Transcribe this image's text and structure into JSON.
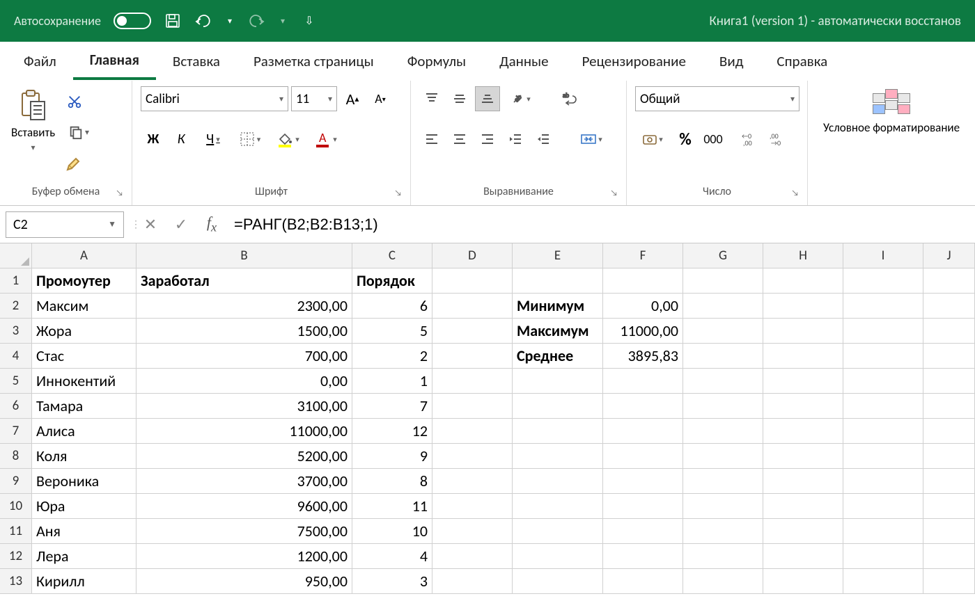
{
  "titlebar": {
    "autosave": "Автосохранение",
    "doc_title": "Книга1 (version 1)  -  автоматически восстанов"
  },
  "tabs": {
    "file": "Файл",
    "home": "Главная",
    "insert": "Вставка",
    "layout": "Разметка страницы",
    "formulas": "Формулы",
    "data": "Данные",
    "review": "Рецензирование",
    "view": "Вид",
    "help": "Справка"
  },
  "ribbon": {
    "clipboard": {
      "paste": "Вставить",
      "label": "Буфер обмена"
    },
    "font": {
      "name": "Calibri",
      "size": "11",
      "label": "Шрифт",
      "bold": "Ж",
      "italic": "К",
      "underline": "Ч"
    },
    "alignment": {
      "label": "Выравнивание"
    },
    "number": {
      "format": "Общий",
      "label": "Число"
    },
    "styles": {
      "cond": "Условное форматирование"
    }
  },
  "formula_bar": {
    "cell_ref": "C2",
    "formula": "=РАНГ(B2;B2:B13;1)"
  },
  "columns": [
    "A",
    "B",
    "C",
    "D",
    "E",
    "F",
    "G",
    "H",
    "I",
    "J"
  ],
  "sheet": {
    "header": {
      "A": "Промоутер",
      "B": "Заработал",
      "C": "Порядок"
    },
    "stats": {
      "min_l": "Минимум",
      "min_v": "0,00",
      "max_l": "Максимум",
      "max_v": "11000,00",
      "avg_l": "Среднее",
      "avg_v": "3895,83"
    },
    "rows": [
      {
        "n": "2",
        "a": "Максим",
        "b": "2300,00",
        "c": "6"
      },
      {
        "n": "3",
        "a": "Жора",
        "b": "1500,00",
        "c": "5"
      },
      {
        "n": "4",
        "a": "Стас",
        "b": "700,00",
        "c": "2"
      },
      {
        "n": "5",
        "a": "Иннокентий",
        "b": "0,00",
        "c": "1"
      },
      {
        "n": "6",
        "a": "Тамара",
        "b": "3100,00",
        "c": "7"
      },
      {
        "n": "7",
        "a": "Алиса",
        "b": "11000,00",
        "c": "12"
      },
      {
        "n": "8",
        "a": "Коля",
        "b": "5200,00",
        "c": "9"
      },
      {
        "n": "9",
        "a": "Вероника",
        "b": "3700,00",
        "c": "8"
      },
      {
        "n": "10",
        "a": "Юра",
        "b": "9600,00",
        "c": "11"
      },
      {
        "n": "11",
        "a": "Аня",
        "b": "7500,00",
        "c": "10"
      },
      {
        "n": "12",
        "a": "Лера",
        "b": "1200,00",
        "c": "4"
      },
      {
        "n": "13",
        "a": "Кирилл",
        "b": "950,00",
        "c": "3"
      }
    ]
  }
}
